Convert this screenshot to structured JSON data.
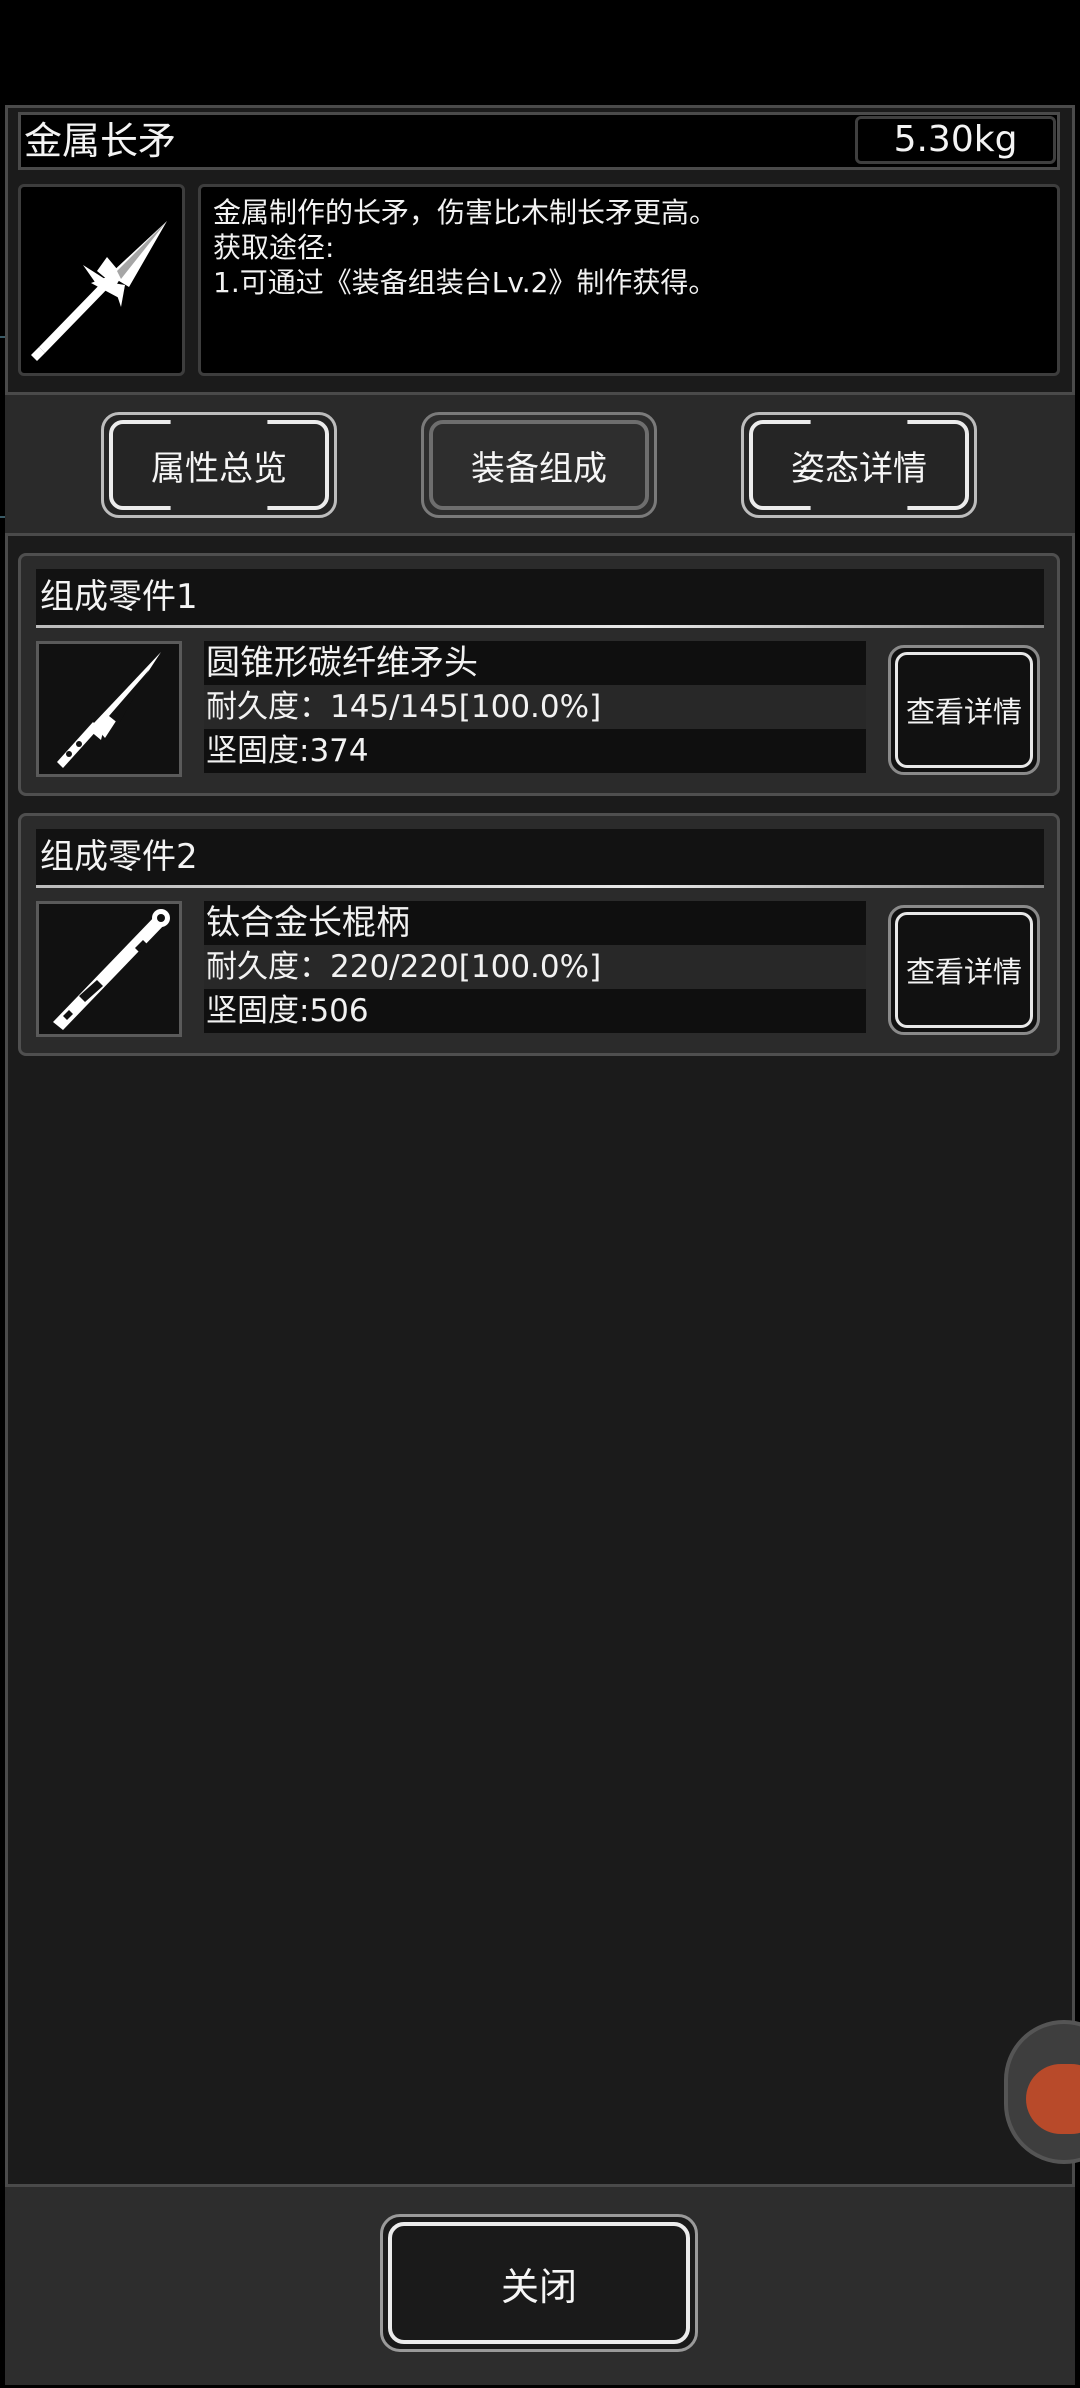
{
  "item": {
    "name": "金属长矛",
    "weight": "5.30kg",
    "icon": "spear-icon",
    "description": [
      "金属制作的长矛，伤害比木制长矛更高。",
      "获取途径:",
      "1.可通过《装备组装台Lv.2》制作获得。"
    ]
  },
  "tabs": [
    {
      "label": "属性总览",
      "active": false
    },
    {
      "label": "装备组成",
      "active": true
    },
    {
      "label": "姿态详情",
      "active": false
    }
  ],
  "components": [
    {
      "title": "组成零件1",
      "icon": "spearhead-icon",
      "name": "圆锥形碳纤维矛头",
      "durability": "耐久度：145/145[100.0%]",
      "firmness": "坚固度:374",
      "button": "查看详情"
    },
    {
      "title": "组成零件2",
      "icon": "staff-handle-icon",
      "name": "钛合金长棍柄",
      "durability": "耐久度：220/220[100.0%]",
      "firmness": "坚固度:506",
      "button": "查看详情"
    }
  ],
  "footer": {
    "close_label": "关闭"
  }
}
